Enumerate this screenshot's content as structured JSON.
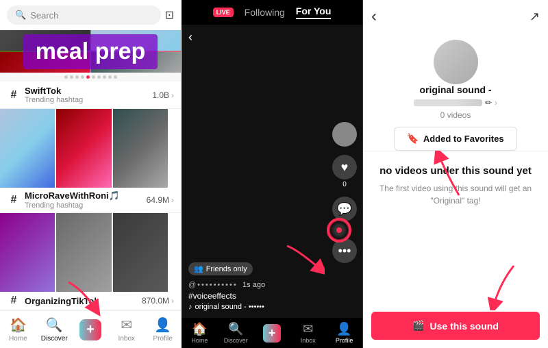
{
  "left": {
    "search_placeholder": "Search",
    "banner_text": "meal prep",
    "dots": [
      1,
      2,
      3,
      4,
      5,
      6,
      7,
      8,
      9,
      10
    ],
    "active_dot": 5,
    "trends": [
      {
        "name": "SwiftTok",
        "sub": "Trending hashtag",
        "count": "1.0B",
        "id": "swifttok"
      },
      {
        "name": "MicroRaveWithRoni🎵",
        "sub": "Trending hashtag",
        "count": "64.9M",
        "id": "microravewithroni"
      },
      {
        "name": "OrganizingTikTok",
        "sub": "",
        "count": "870.0M",
        "id": "organizingtiktok"
      }
    ],
    "nav": [
      {
        "label": "Home",
        "icon": "🏠"
      },
      {
        "label": "Discover",
        "icon": "🔍",
        "active": true
      },
      {
        "label": "",
        "icon": "+",
        "plus": true
      },
      {
        "label": "Inbox",
        "icon": "✉"
      },
      {
        "label": "Profile",
        "icon": "👤"
      }
    ]
  },
  "mid": {
    "live_label": "LIVE",
    "tab_following": "Following",
    "tab_foryou": "For You",
    "friends_badge": "Friends only",
    "user_handle": "@••••••••••",
    "time_ago": "1s ago",
    "caption": "#voiceeffects",
    "sound_note": "♪",
    "sound_name": "original sound - ••••••",
    "nav": [
      {
        "label": "Home",
        "icon": "🏠"
      },
      {
        "label": "Discover",
        "icon": "🔍"
      },
      {
        "label": "",
        "icon": "+",
        "plus": true
      },
      {
        "label": "Inbox",
        "icon": "✉"
      },
      {
        "label": "Profile",
        "icon": "👤",
        "active": true
      }
    ]
  },
  "right": {
    "back_icon": "‹",
    "share_icon": "↗",
    "sound_title": "original sound -",
    "creator_bar_placeholder": "••••••••••••",
    "video_count": "0 videos",
    "fav_btn_label": "Added to Favorites",
    "fav_icon": "🔖",
    "no_videos_title": "no videos under this sound yet",
    "no_videos_sub": "The first video using this sound will get an \"Original\" tag!",
    "use_sound_label": "Use this sound",
    "use_sound_icon": "🎬"
  }
}
